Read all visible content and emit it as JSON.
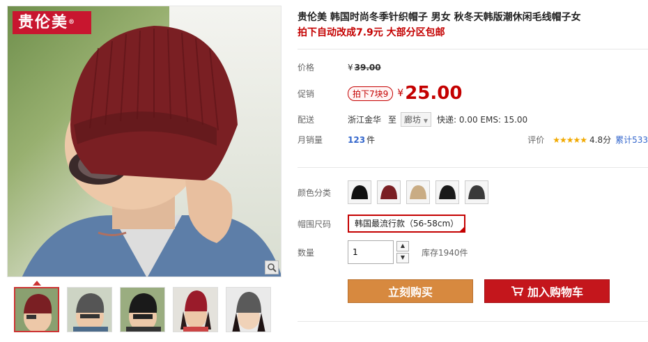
{
  "brand_logo": "贵伦美",
  "product": {
    "title": "贵伦美 韩国时尚冬季针织帽子 男女 秋冬天韩版潮休闲毛线帽子女",
    "promo": "拍下自动改成7.9元 大部分区包邮"
  },
  "price": {
    "label": "价格",
    "currency": "¥",
    "original": "39.00"
  },
  "promotion": {
    "label": "促销",
    "tag": "拍下7块9",
    "price": "25.00"
  },
  "shipping": {
    "label": "配送",
    "origin": "浙江金华",
    "to": "至",
    "destination": "廊坊",
    "fees": "快递: 0.00 EMS: 15.00"
  },
  "sales": {
    "label": "月销量",
    "count": "123",
    "unit": "件",
    "rating_label": "评价",
    "stars": "★★★★★",
    "score": "4.8分",
    "cumulative": "累计533"
  },
  "colors": {
    "label": "颜色分类",
    "swatches": [
      "black",
      "wine-red",
      "khaki",
      "black",
      "dark-gray"
    ]
  },
  "size": {
    "label": "帽围尺码",
    "option": "韩国最流行款（56-58cm）"
  },
  "quantity": {
    "label": "数量",
    "value": "1",
    "stock": "库存1940件"
  },
  "actions": {
    "buy_now": "立刻购买",
    "add_to_cart": "加入购物车"
  },
  "colors_palette": {
    "accent_red": "#c40000",
    "buy_orange": "#d7893f",
    "cart_red": "#c4161c",
    "star_gold": "#f1a900",
    "link_blue": "#3366cc"
  }
}
